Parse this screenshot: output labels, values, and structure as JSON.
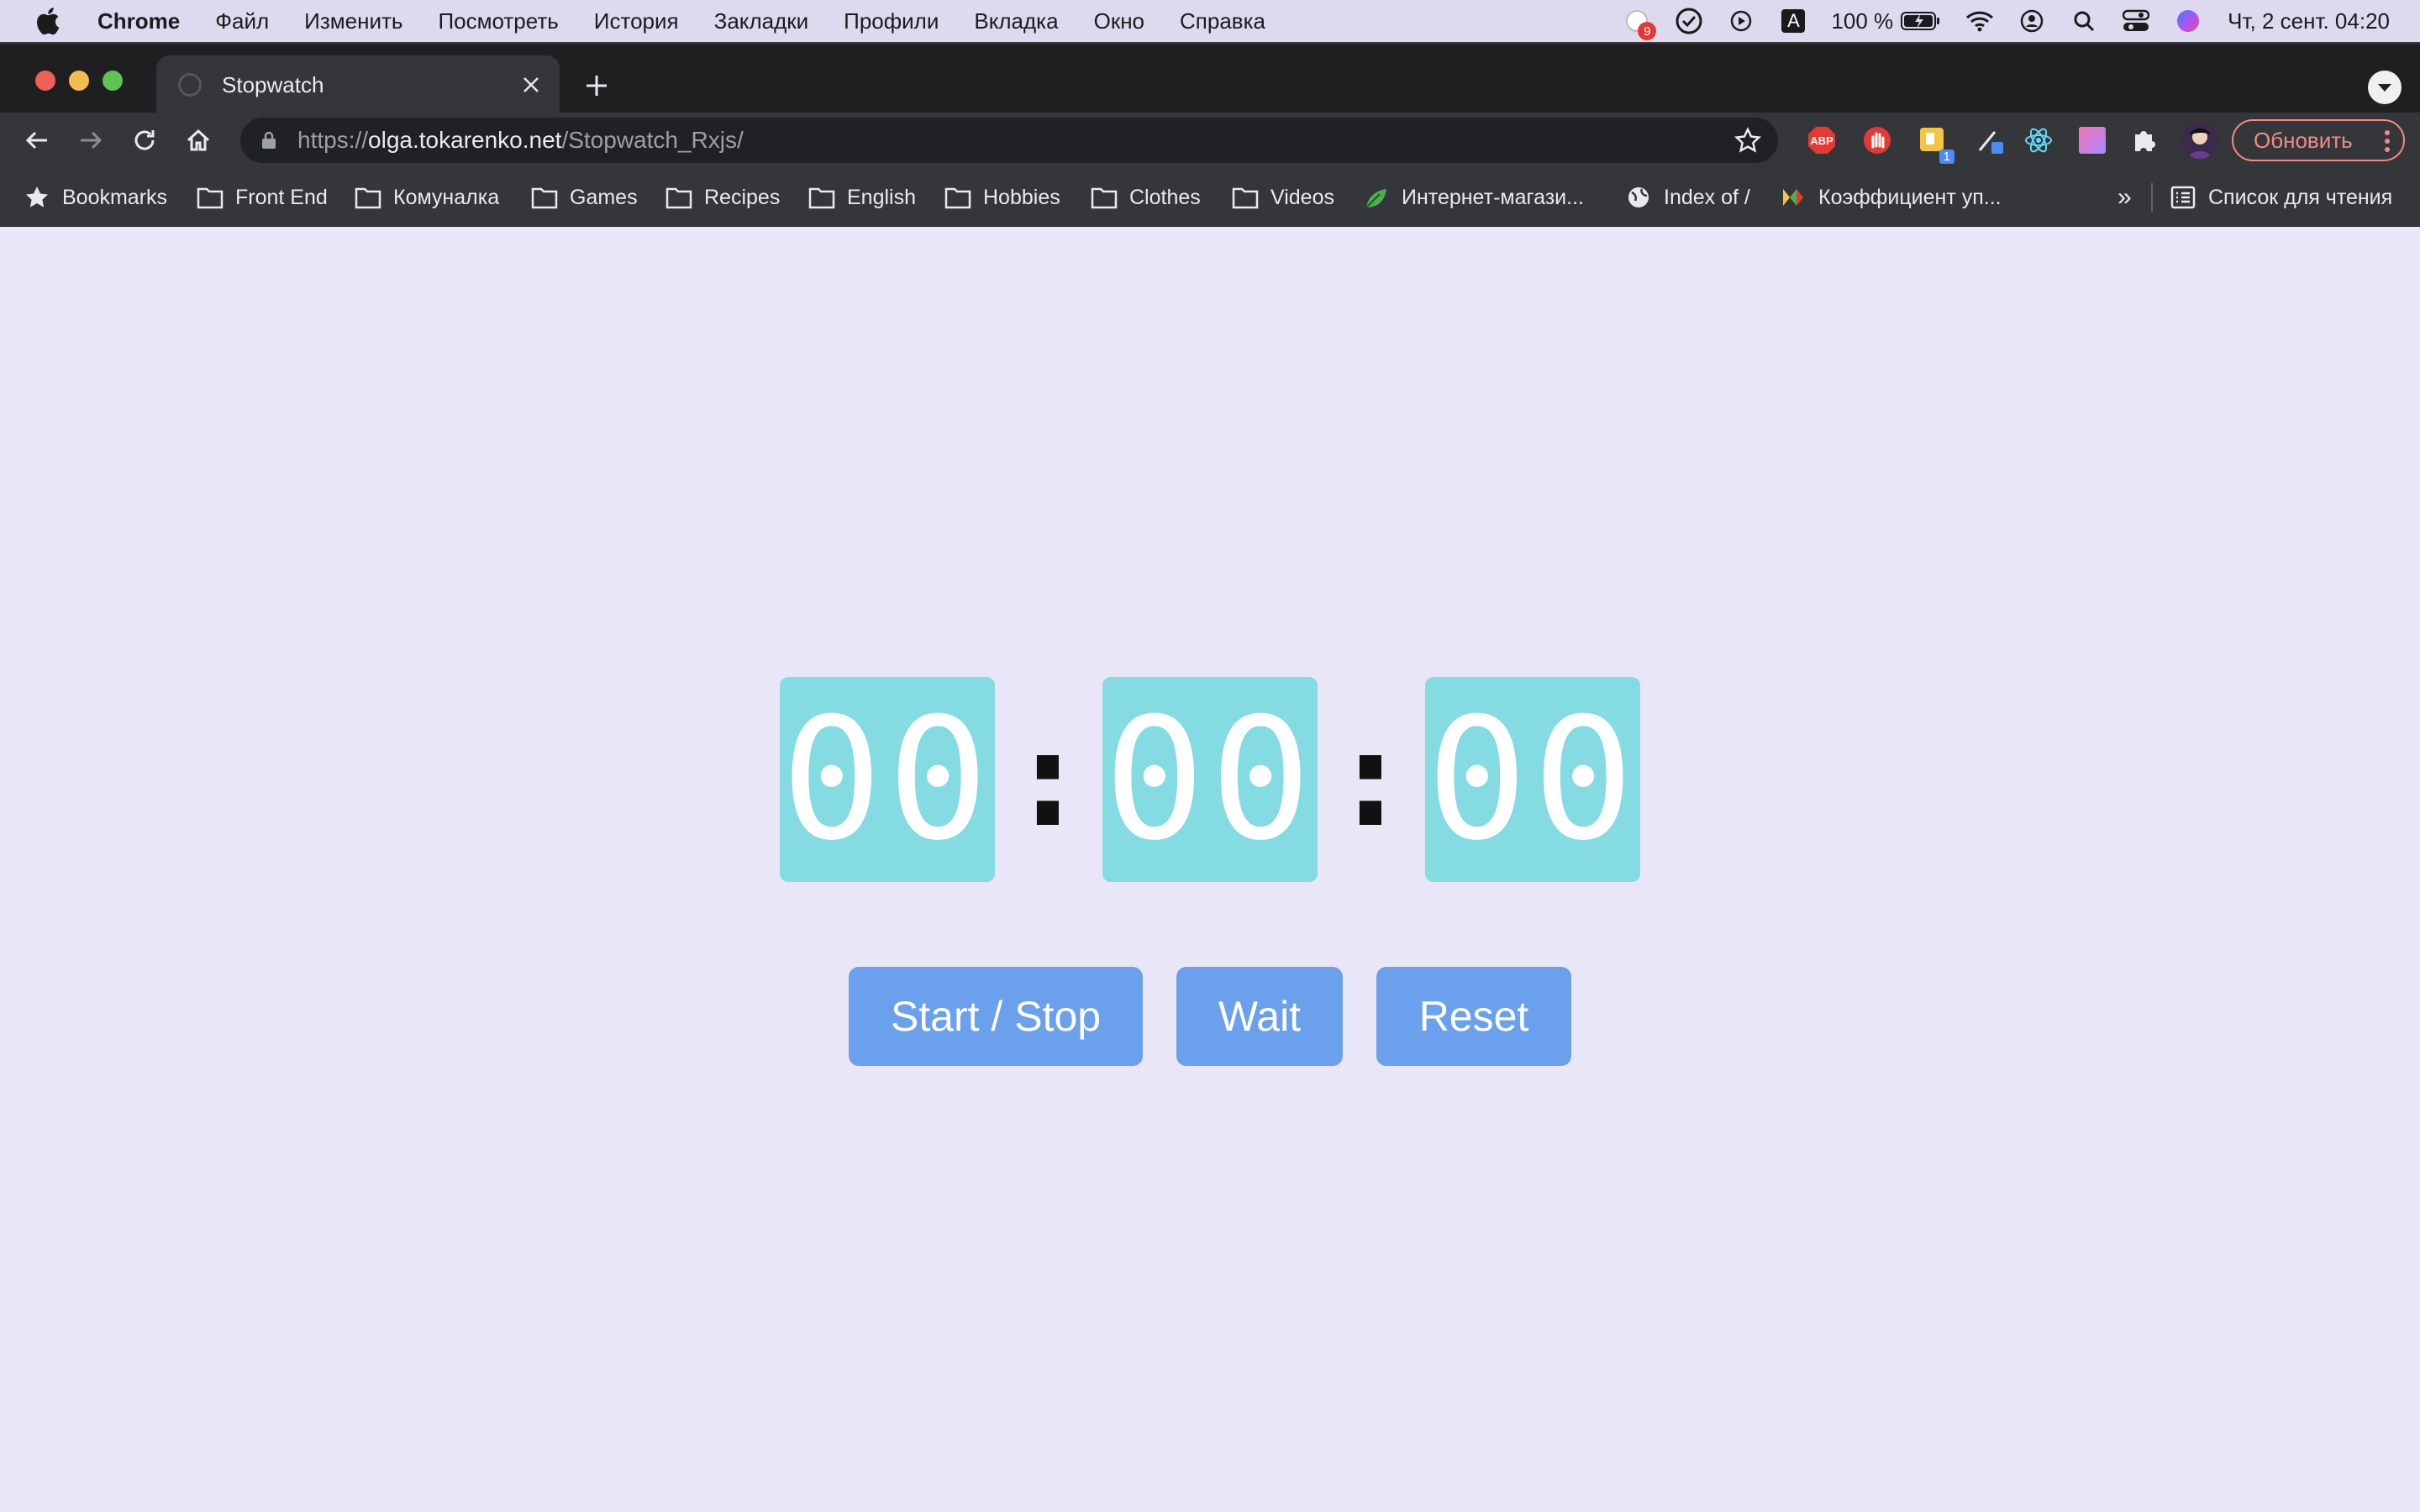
{
  "menubar": {
    "app_name": "Chrome",
    "items": [
      "Файл",
      "Изменить",
      "Посмотреть",
      "История",
      "Закладки",
      "Профили",
      "Вкладка",
      "Окно",
      "Справка"
    ],
    "notification_count": "9",
    "keyboard_layout": "A",
    "battery": "100 %",
    "datetime": "Чт, 2 сент.  04:20"
  },
  "tab": {
    "title": "Stopwatch"
  },
  "omnibox": {
    "scheme": "https://",
    "host": "olga.tokarenko.net",
    "path": "/Stopwatch_Rxjs/"
  },
  "extensions": {
    "abp_label": "ABP",
    "badge_count": "1"
  },
  "update_button": "Обновить",
  "bookmarks": {
    "items": [
      {
        "label": "Bookmarks",
        "icon": "star-icon"
      },
      {
        "label": "Front End",
        "icon": "folder-icon"
      },
      {
        "label": "Комуналка",
        "icon": "folder-icon"
      },
      {
        "label": "Games",
        "icon": "folder-icon"
      },
      {
        "label": "Recipes",
        "icon": "folder-icon"
      },
      {
        "label": "English",
        "icon": "folder-icon"
      },
      {
        "label": "Hobbies",
        "icon": "folder-icon"
      },
      {
        "label": "Clothes",
        "icon": "folder-icon"
      },
      {
        "label": "Videos",
        "icon": "folder-icon"
      },
      {
        "label": "Интернет-магази...",
        "icon": "leaf-icon"
      },
      {
        "label": "Index of /",
        "icon": "globe-icon"
      },
      {
        "label": "Коэффициент уп...",
        "icon": "site-icon"
      }
    ],
    "overflow": "»",
    "reading_list": "Список для чтения"
  },
  "stopwatch": {
    "hours": "00",
    "minutes": "00",
    "seconds": "00",
    "separator": ":",
    "buttons": {
      "start_stop": "Start / Stop",
      "wait": "Wait",
      "reset": "Reset"
    }
  },
  "colors": {
    "page_bg": "#e8e6f7",
    "digit_bg": "#84dbe2",
    "button_bg": "#6aa0ec",
    "update_accent": "#f28b82"
  }
}
